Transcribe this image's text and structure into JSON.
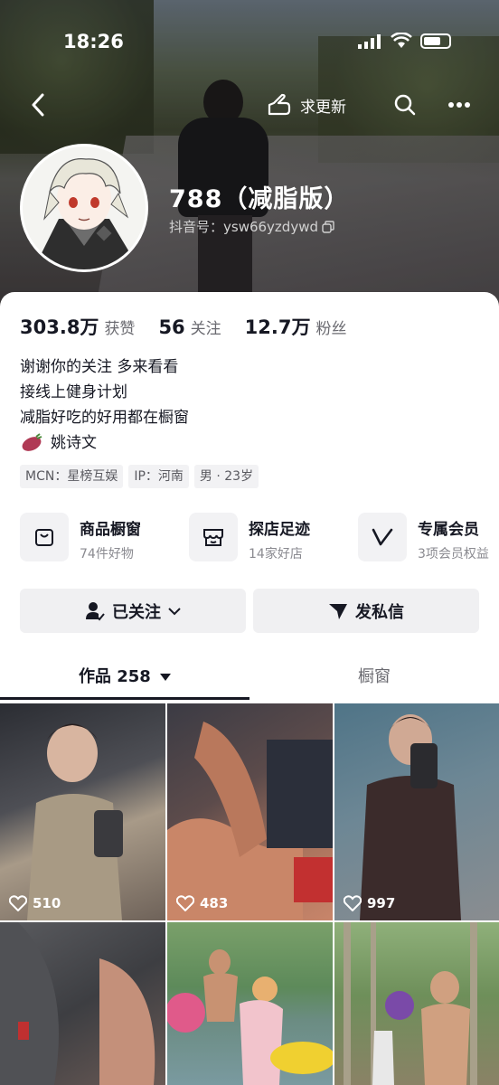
{
  "status_bar": {
    "time": "18:26"
  },
  "top_bar": {
    "request_update_label": "求更新"
  },
  "profile": {
    "nickname": "788（减脂版）",
    "douyin_id": "抖音号：ysw66yzdywd"
  },
  "stats": [
    {
      "value": "303.8万",
      "label": "获赞"
    },
    {
      "value": "56",
      "label": "关注"
    },
    {
      "value": "12.7万",
      "label": "粉丝"
    }
  ],
  "bio": {
    "lines": [
      "谢谢你的关注 多来看看",
      "接线上健身计划",
      "减脂好吃的好用都在橱窗"
    ],
    "mention": "姚诗文"
  },
  "tags": [
    "MCN：星榜互娱",
    "IP：河南",
    "男 · 23岁"
  ],
  "services": [
    {
      "title": "商品橱窗",
      "sub": "74件好物",
      "icon": "bag-icon"
    },
    {
      "title": "探店足迹",
      "sub": "14家好店",
      "icon": "store-icon"
    },
    {
      "title": "专属会员",
      "sub": "3项会员权益",
      "icon": "vip-icon"
    }
  ],
  "actions": {
    "follow_label": "已关注",
    "message_label": "发私信"
  },
  "tabs": {
    "works_label": "作品 258",
    "shop_label": "橱窗"
  },
  "videos": [
    {
      "likes": "510"
    },
    {
      "likes": "483"
    },
    {
      "likes": "997"
    },
    {
      "likes": ""
    },
    {
      "likes": ""
    },
    {
      "likes": ""
    }
  ],
  "colors": {
    "text": "#161823",
    "muted": "#6a6a70",
    "chip": "#f0f0f2"
  }
}
